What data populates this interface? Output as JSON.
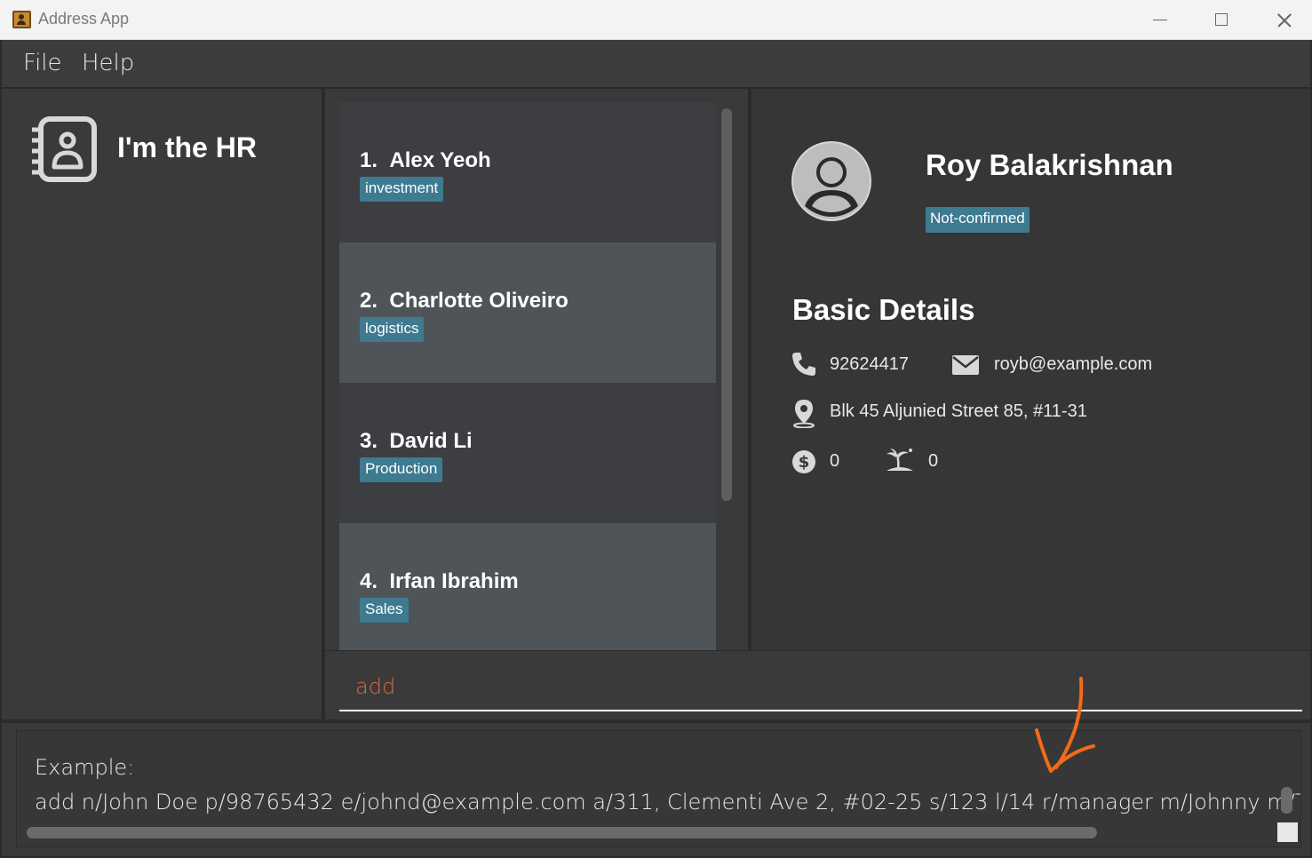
{
  "window": {
    "title": "Address App",
    "minimize_icon": "minimize-icon",
    "maximize_icon": "maximize-icon",
    "close_icon": "close-icon"
  },
  "menu": {
    "file": "File",
    "help": "Help"
  },
  "sidebar": {
    "icon": "address-book-icon",
    "title": "I'm the HR"
  },
  "persons": [
    {
      "index": "1.",
      "name": "Alex Yeoh",
      "tag": "investment"
    },
    {
      "index": "2.",
      "name": "Charlotte Oliveiro",
      "tag": "logistics"
    },
    {
      "index": "3.",
      "name": "David Li",
      "tag": "Production"
    },
    {
      "index": "4.",
      "name": "Irfan Ibrahim",
      "tag": "Sales"
    }
  ],
  "detail": {
    "name": "Roy Balakrishnan",
    "status_tag": "Not-confirmed",
    "section_title": "Basic Details",
    "phone": "92624417",
    "email": "royb@example.com",
    "address": "Blk 45 Aljunied Street 85, #11-31",
    "salary": "0",
    "leave": "0"
  },
  "command": {
    "value": "add"
  },
  "result": {
    "line1": "Example:",
    "line2": "add n/John Doe p/98765432 e/johnd@example.com a/311, Clementi Ave 2, #02-25 s/123 l/14 r/manager m/Johnny m/Tom d/inv"
  },
  "colors": {
    "tag": "#3e7b91",
    "command_text": "#e0663c",
    "annotation": "#f26a1b"
  }
}
